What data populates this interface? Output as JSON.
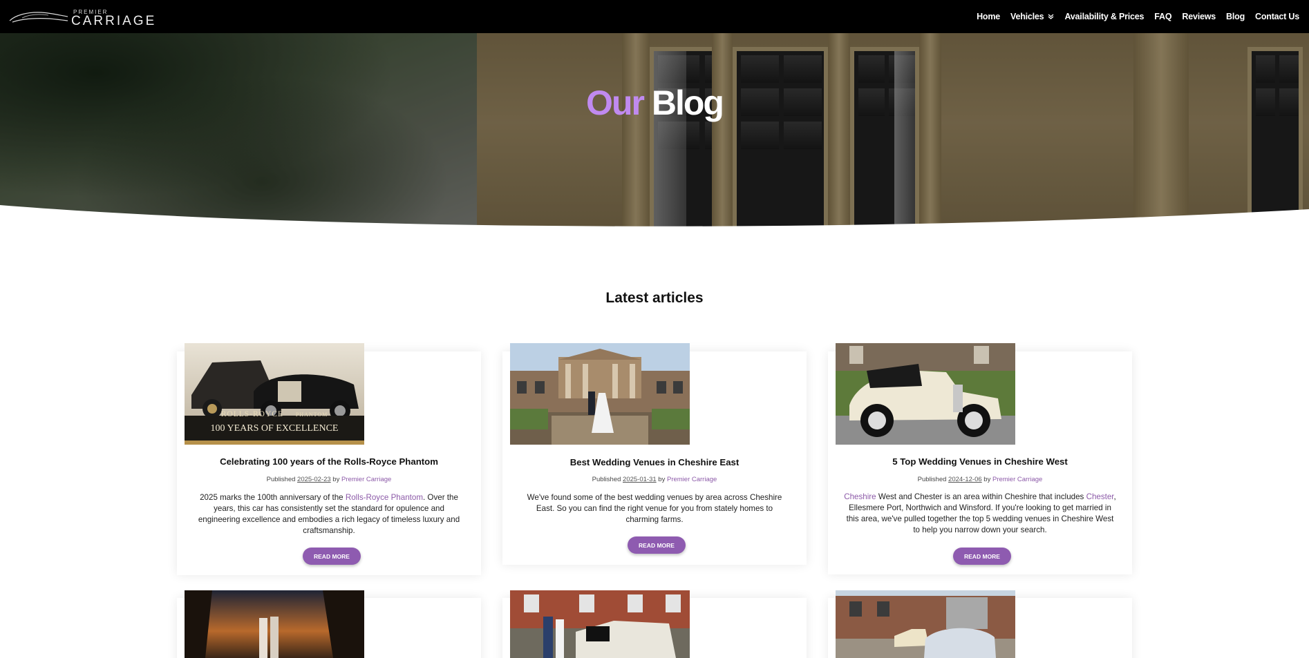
{
  "nav": {
    "logo_top": "PREMIER",
    "logo_main": "CARRIAGE",
    "items": [
      {
        "label": "Home"
      },
      {
        "label": "Vehicles",
        "icon": "chevron-down-icon"
      },
      {
        "label": "Availability & Prices"
      },
      {
        "label": "FAQ"
      },
      {
        "label": "Reviews"
      },
      {
        "label": "Blog"
      },
      {
        "label": "Contact Us"
      }
    ]
  },
  "hero": {
    "title_part1": "Our",
    "title_part2": "Blog",
    "accent_color": "#c08af0"
  },
  "section": {
    "title": "Latest articles"
  },
  "posts": [
    {
      "title": "Celebrating 100 years of the Rolls-Royce Phantom",
      "published_label": "Published",
      "date": "2025-02-23",
      "by_label": "by",
      "author": "Premier Carriage",
      "excerpt_lines": [
        [
          "2025 marks the 100th anniversary of the ",
          "Rolls-Royce Phantom",
          ". Over the"
        ],
        [
          "years, this car has consistently set the standard for opulence and"
        ],
        [
          "engineering excellence and embodies a rich legacy of timeless luxury and"
        ],
        [
          "craftsmanship."
        ]
      ],
      "button": "READ MORE",
      "image_caption_1": "ROLLS-ROYCE",
      "image_caption_2": "PHANTOM",
      "image_caption_3": "100 YEARS OF EXCELLENCE"
    },
    {
      "title": "Best Wedding Venues in Cheshire East",
      "published_label": "Published",
      "date": "2025-01-31",
      "by_label": "by",
      "author": "Premier Carriage",
      "excerpt_lines": [
        [
          "We've found some of the best wedding venues by area across Cheshire"
        ],
        [
          "East. So you can find the right venue for you from stately homes to"
        ],
        [
          "charming farms."
        ]
      ],
      "button": "READ MORE"
    },
    {
      "title": "5 Top Wedding Venues in Cheshire West",
      "published_label": "Published",
      "date": "2024-12-06",
      "by_label": "by",
      "author": "Premier Carriage",
      "excerpt_lines": [
        [
          "",
          "Cheshire",
          " West and Chester is an area within Cheshire that includes ",
          "Chester",
          ","
        ],
        [
          "Ellesmere Port, Northwich and Winsford. If you're looking to get married in"
        ],
        [
          "this area, we've pulled together the top 5 wedding venues in Cheshire West"
        ],
        [
          "to help you narrow down your search."
        ]
      ],
      "button": "READ MORE"
    }
  ],
  "colors": {
    "button": "#8e5bb0",
    "link": "#8c5aa8"
  }
}
